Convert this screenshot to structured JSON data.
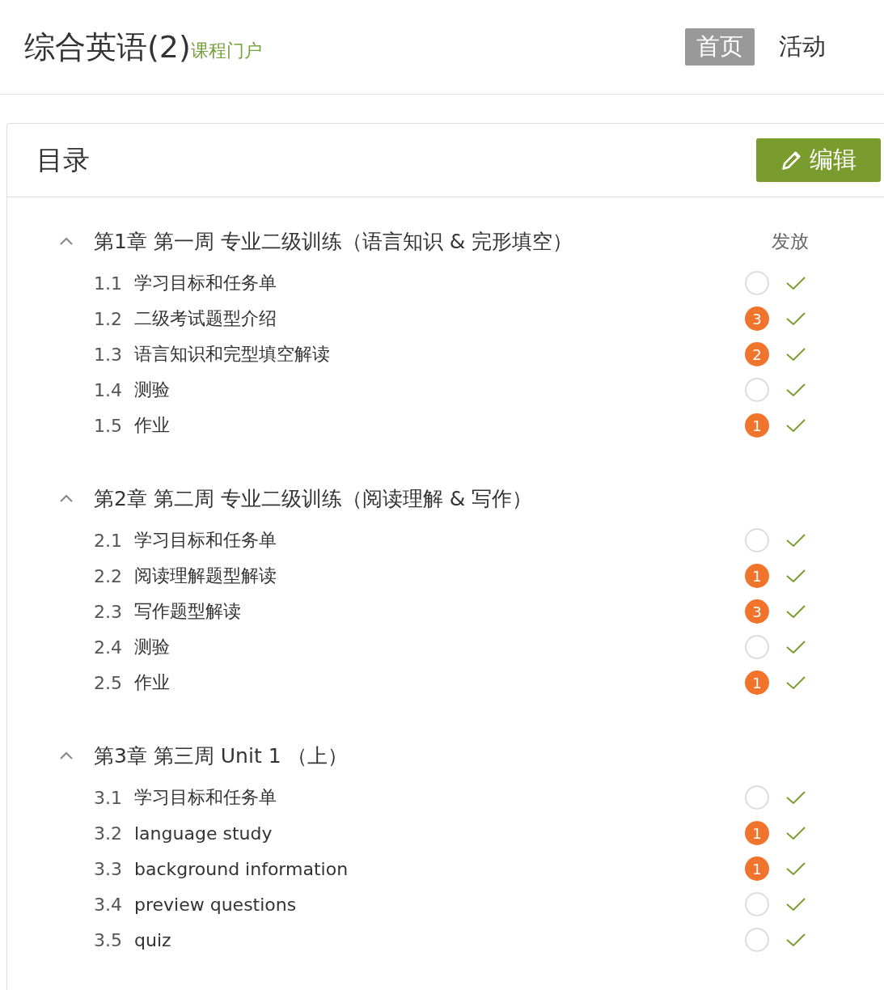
{
  "header": {
    "title": "综合英语(2)",
    "subtitle": "课程门户"
  },
  "nav": [
    {
      "label": "首页",
      "selected": true
    },
    {
      "label": "活动",
      "selected": false
    }
  ],
  "catalog": {
    "title": "目录",
    "edit_button": "编辑",
    "release_column": "发放",
    "chapters": [
      {
        "title": "第1章 第一周 专业二级训练（语言知识 & 完形填空）",
        "expanded": true,
        "lessons": [
          {
            "number": "1.1",
            "title": "学习目标和任务单",
            "released": true
          },
          {
            "number": "1.2",
            "title": "二级考试题型介绍",
            "count": "3",
            "released": true
          },
          {
            "number": "1.3",
            "title": "语言知识和完型填空解读",
            "count": "2",
            "released": true
          },
          {
            "number": "1.4",
            "title": "测验",
            "released": true
          },
          {
            "number": "1.5",
            "title": "作业",
            "count": "1",
            "released": true
          }
        ]
      },
      {
        "title": "第2章 第二周 专业二级训练（阅读理解 & 写作）",
        "expanded": true,
        "lessons": [
          {
            "number": "2.1",
            "title": "学习目标和任务单",
            "released": true
          },
          {
            "number": "2.2",
            "title": "阅读理解题型解读",
            "count": "1",
            "released": true
          },
          {
            "number": "2.3",
            "title": "写作题型解读",
            "count": "3",
            "released": true
          },
          {
            "number": "2.4",
            "title": "测验",
            "released": true
          },
          {
            "number": "2.5",
            "title": "作业",
            "count": "1",
            "released": true
          }
        ]
      },
      {
        "title": "第3章 第三周 Unit 1 （上）",
        "expanded": true,
        "lessons": [
          {
            "number": "3.1",
            "title": "学习目标和任务单",
            "released": true
          },
          {
            "number": "3.2",
            "title": "language study",
            "count": "1",
            "released": true
          },
          {
            "number": "3.3",
            "title": "background information",
            "count": "1",
            "released": true
          },
          {
            "number": "3.4",
            "title": "preview questions",
            "released": true
          },
          {
            "number": "3.5",
            "title": "quiz",
            "released": true
          }
        ]
      }
    ]
  }
}
